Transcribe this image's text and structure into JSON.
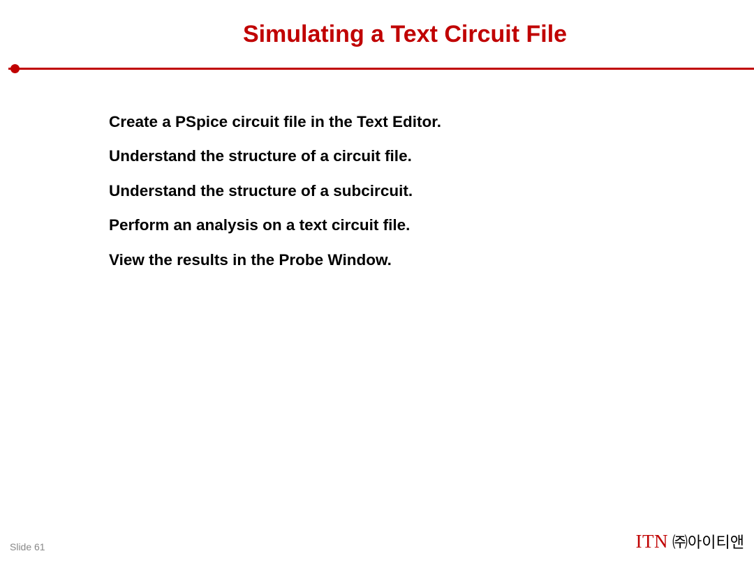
{
  "title": "Simulating a Text Circuit File",
  "bullets": [
    "Create a PSpice circuit file in the Text Editor.",
    "Understand the structure of a circuit file.",
    "Understand the structure of a subcircuit.",
    "Perform an analysis on a text circuit file.",
    "View the results in the Probe Window."
  ],
  "footer": {
    "slide_label": "Slide 61",
    "logo_en": "ITN",
    "logo_ko": "㈜아이티앤"
  }
}
